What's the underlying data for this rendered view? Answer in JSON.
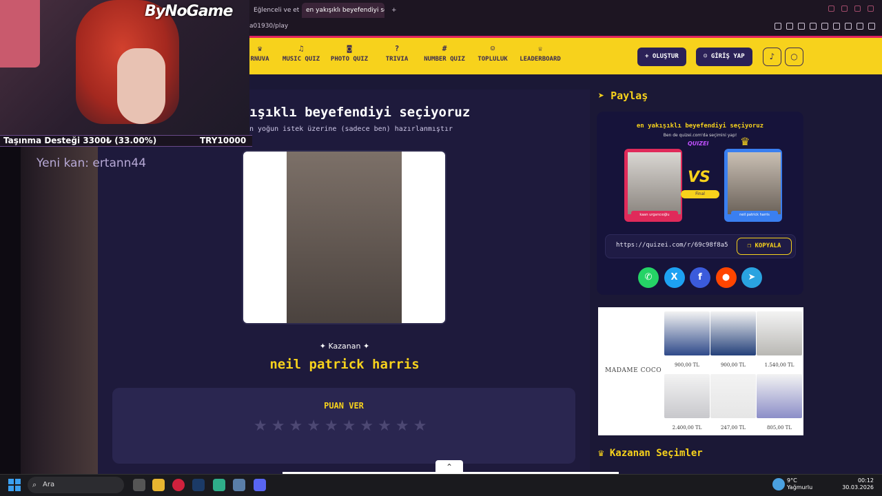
{
  "browser": {
    "tabs": [
      {
        "label": "Eğlenceli ve etkile"
      },
      {
        "label": "en yakışıklı beyefendiyi se"
      }
    ],
    "url": "a01930/play"
  },
  "stream": {
    "logo": "ByNoGame",
    "donation": "Taşınma Desteği 3300₺ (33.00%)",
    "donation_goal": "TRY10000",
    "new_sub": "Yeni kan: ertann44"
  },
  "nav": {
    "items": [
      {
        "label": "RNUVA",
        "icon": "trophy-icon"
      },
      {
        "label": "MUSIC QUIZ",
        "icon": "music-icon"
      },
      {
        "label": "PHOTO QUIZ",
        "icon": "camera-icon"
      },
      {
        "label": "TRIVIA",
        "icon": "question-icon"
      },
      {
        "label": "NUMBER QUIZ",
        "icon": "hash-icon"
      },
      {
        "label": "TOPLULUK",
        "icon": "users-icon"
      },
      {
        "label": "LEADERBOARD",
        "icon": "medal-icon"
      }
    ],
    "create_label": "OLUŞTUR",
    "login_label": "GİRİŞ YAP"
  },
  "quiz": {
    "title": "ışıklı beyefendiyi seçiyoruz",
    "subtitle": "n yoğun istek üzerine (sadece ben) hazırlanmıştır",
    "winner_label": "Kazanan",
    "winner_name": "neil patrick harris",
    "rate_title": "PUAN VER",
    "rating": {
      "max": 10,
      "value": 0
    }
  },
  "share": {
    "heading": "Paylaş",
    "card_title": "en yakışıklı beyefendiyi seçiyoruz",
    "card_subtitle": "Ben de quizei.com'da seçimini yap!",
    "brand": "QUIZEI",
    "candidate_a": "kaan urgancıoğlu",
    "candidate_b": "neil patrick harris",
    "vs": "VS",
    "final_badge": "Final",
    "link": "https://quizei.com/r/69c98f8a5",
    "copy_label": "KOPYALA",
    "socials": [
      {
        "name": "whatsapp-icon",
        "color": "#25d366",
        "glyph": "✆"
      },
      {
        "name": "x-twitter-icon",
        "color": "#1da1f2",
        "glyph": "X"
      },
      {
        "name": "facebook-icon",
        "color": "#3b5bdb",
        "glyph": "f"
      },
      {
        "name": "reddit-icon",
        "color": "#ff4500",
        "glyph": "●"
      },
      {
        "name": "telegram-icon",
        "color": "#2aa3e0",
        "glyph": "➤"
      }
    ]
  },
  "ad": {
    "brand": "MADAME COCO",
    "products": [
      {
        "price": "900,00 TL"
      },
      {
        "price": "900,00 TL"
      },
      {
        "price": "1.540,00 TL"
      },
      {
        "price": "2.400,00 TL"
      },
      {
        "price": "247,00 TL"
      },
      {
        "price": "805,00 TL"
      }
    ]
  },
  "winners_heading": "Kazanan Seçimler",
  "taskbar": {
    "search_placeholder": "Ara",
    "weather_temp": "9°C",
    "weather_desc": "Yağmurlu",
    "time": "00:12",
    "date": "30.03.2026"
  }
}
